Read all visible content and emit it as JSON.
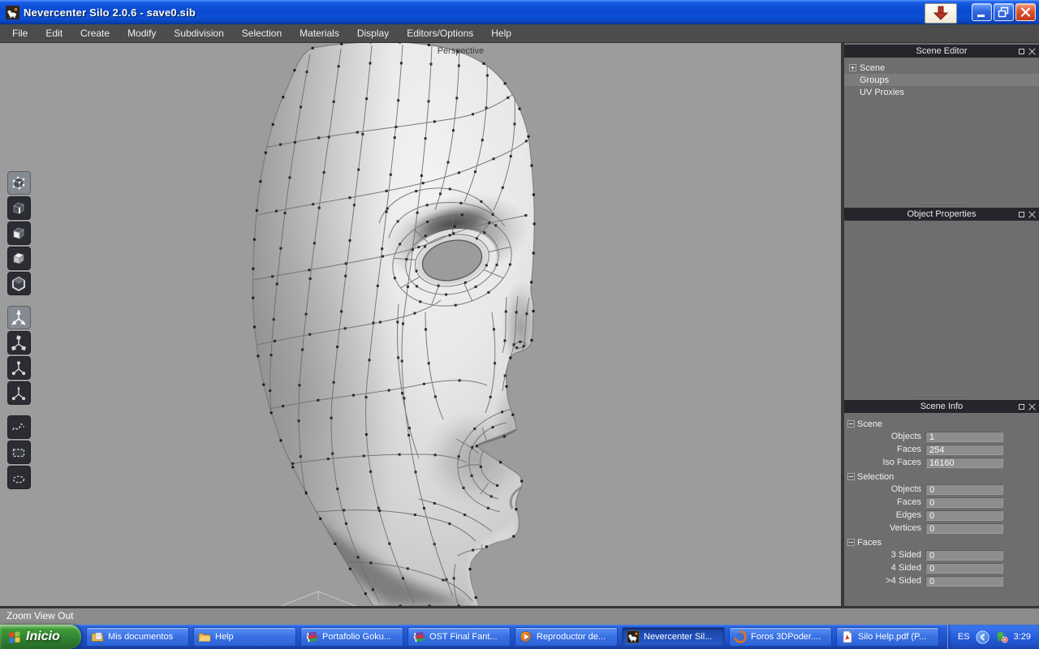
{
  "window": {
    "title": "Nevercenter Silo 2.0.6 - save0.sib",
    "controls": {
      "download": "download-arrow",
      "minimize": "minimize",
      "restore": "restore",
      "close": "close"
    }
  },
  "menu": {
    "items": [
      "File",
      "Edit",
      "Create",
      "Modify",
      "Subdivision",
      "Selection",
      "Materials",
      "Display",
      "Editors/Options",
      "Help"
    ]
  },
  "toolbar": {
    "tools": [
      {
        "name": "select-vertices",
        "selected": true
      },
      {
        "name": "select-edges",
        "selected": false
      },
      {
        "name": "select-faces",
        "selected": false
      },
      {
        "name": "select-objects",
        "selected": false
      },
      {
        "name": "select-multi",
        "selected": false
      },
      {
        "name": "manipulator-move",
        "selected": true
      },
      {
        "name": "manipulator-rotate",
        "selected": false
      },
      {
        "name": "manipulator-scale",
        "selected": false
      },
      {
        "name": "manipulator-universal",
        "selected": false
      },
      {
        "name": "soft-selection",
        "selected": false
      },
      {
        "name": "rect-select",
        "selected": false
      },
      {
        "name": "paint-select",
        "selected": false
      }
    ]
  },
  "viewport": {
    "label": "Perspective"
  },
  "panels": {
    "scene_editor": {
      "title": "Scene Editor",
      "items": [
        "Scene",
        "Groups",
        "UV Proxies"
      ]
    },
    "object_properties": {
      "title": "Object Properties"
    },
    "scene_info": {
      "title": "Scene Info",
      "groups": [
        {
          "label": "Scene",
          "rows": [
            {
              "label": "Objects",
              "value": "1"
            },
            {
              "label": "Faces",
              "value": "254"
            },
            {
              "label": "Iso Faces",
              "value": "16160"
            }
          ]
        },
        {
          "label": "Selection",
          "rows": [
            {
              "label": "Objects",
              "value": "0"
            },
            {
              "label": "Faces",
              "value": "0"
            },
            {
              "label": "Edges",
              "value": "0"
            },
            {
              "label": "Vertices",
              "value": "0"
            }
          ]
        },
        {
          "label": "Faces",
          "rows": [
            {
              "label": "3 Sided",
              "value": "0"
            },
            {
              "label": "4 Sided",
              "value": "0"
            },
            {
              "label": ">4 Sided",
              "value": "0"
            }
          ]
        }
      ]
    }
  },
  "statusbar": {
    "text": "Zoom View Out"
  },
  "taskbar": {
    "start_label": "Inicio",
    "items": [
      {
        "label": "Mis documentos",
        "icon": "documents-folder-icon"
      },
      {
        "label": "Help",
        "icon": "folder-icon"
      },
      {
        "label": "Portafolio Goku...",
        "icon": "winrar-icon"
      },
      {
        "label": "OST Final Fant...",
        "icon": "winrar-icon"
      },
      {
        "label": "Reproductor de...",
        "icon": "media-player-icon"
      },
      {
        "label": "Nevercenter Sil...",
        "icon": "silo-icon"
      },
      {
        "label": "Foros 3DPoder....",
        "icon": "firefox-icon"
      },
      {
        "label": "Silo Help.pdf (P...",
        "icon": "pdf-icon"
      }
    ],
    "tray": {
      "language": "ES",
      "time": "3:29"
    }
  },
  "colors": {
    "titlebar_blue": "#0a4ad0",
    "taskbar_blue": "#2257d4",
    "start_green": "#2f8030",
    "viewport_gray": "#9c9c9c",
    "panel_gray": "#6e6e6e",
    "panel_header_dark": "#24262b",
    "close_red": "#dd5230"
  }
}
